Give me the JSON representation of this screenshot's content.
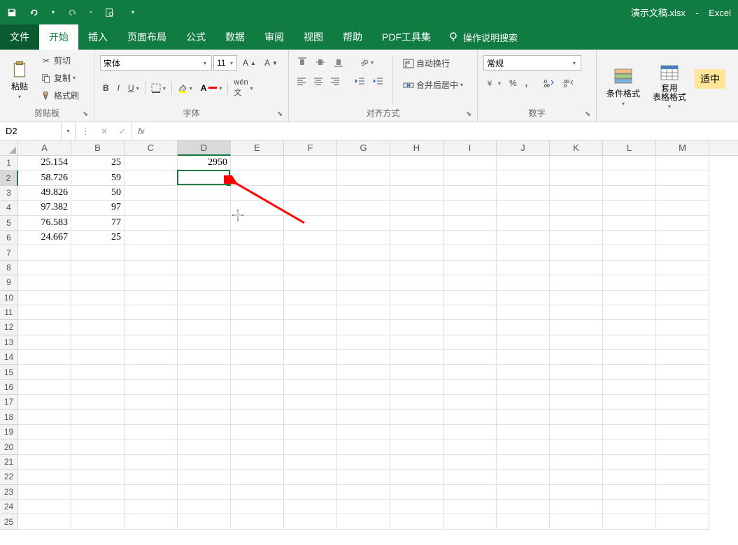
{
  "title": {
    "filename": "演示文稿.xlsx",
    "sep": "-",
    "app": "Excel"
  },
  "qat": {
    "save": "save-icon",
    "undo": "undo-icon",
    "redo": "redo-icon",
    "preview": "preview-icon"
  },
  "tabs": {
    "file": "文件",
    "home": "开始",
    "insert": "插入",
    "layout": "页面布局",
    "formulas": "公式",
    "data": "数据",
    "review": "审阅",
    "view": "视图",
    "help": "帮助",
    "pdf": "PDF工具集",
    "tellme": "操作说明搜索"
  },
  "ribbon": {
    "clipboard": {
      "label": "剪贴板",
      "paste": "粘贴",
      "cut": "剪切",
      "copy": "复制",
      "format_painter": "格式刷"
    },
    "font": {
      "label": "字体",
      "name": "宋体",
      "size": "11"
    },
    "alignment": {
      "label": "对齐方式",
      "wrap": "自动换行",
      "merge": "合并后居中"
    },
    "number": {
      "label": "数字",
      "format": "常规"
    },
    "styles": {
      "cond_fmt": "条件格式",
      "table_fmt": "套用\n表格格式",
      "highlight": "适中"
    }
  },
  "fx": {
    "name_box": "D2",
    "formula": ""
  },
  "grid": {
    "cols": [
      "A",
      "B",
      "C",
      "D",
      "E",
      "F",
      "G",
      "H",
      "I",
      "J",
      "K",
      "L",
      "M"
    ],
    "selected_col_idx": 3,
    "selected_row_idx": 1,
    "rows": 25,
    "data": {
      "0": {
        "A": "25.154",
        "B": "25",
        "D": "2950"
      },
      "1": {
        "A": "58.726",
        "B": "59"
      },
      "2": {
        "A": "49.826",
        "B": "50"
      },
      "3": {
        "A": "97.382",
        "B": "97"
      },
      "4": {
        "A": "76.583",
        "B": "77"
      },
      "5": {
        "A": "24.667",
        "B": "25"
      }
    }
  }
}
